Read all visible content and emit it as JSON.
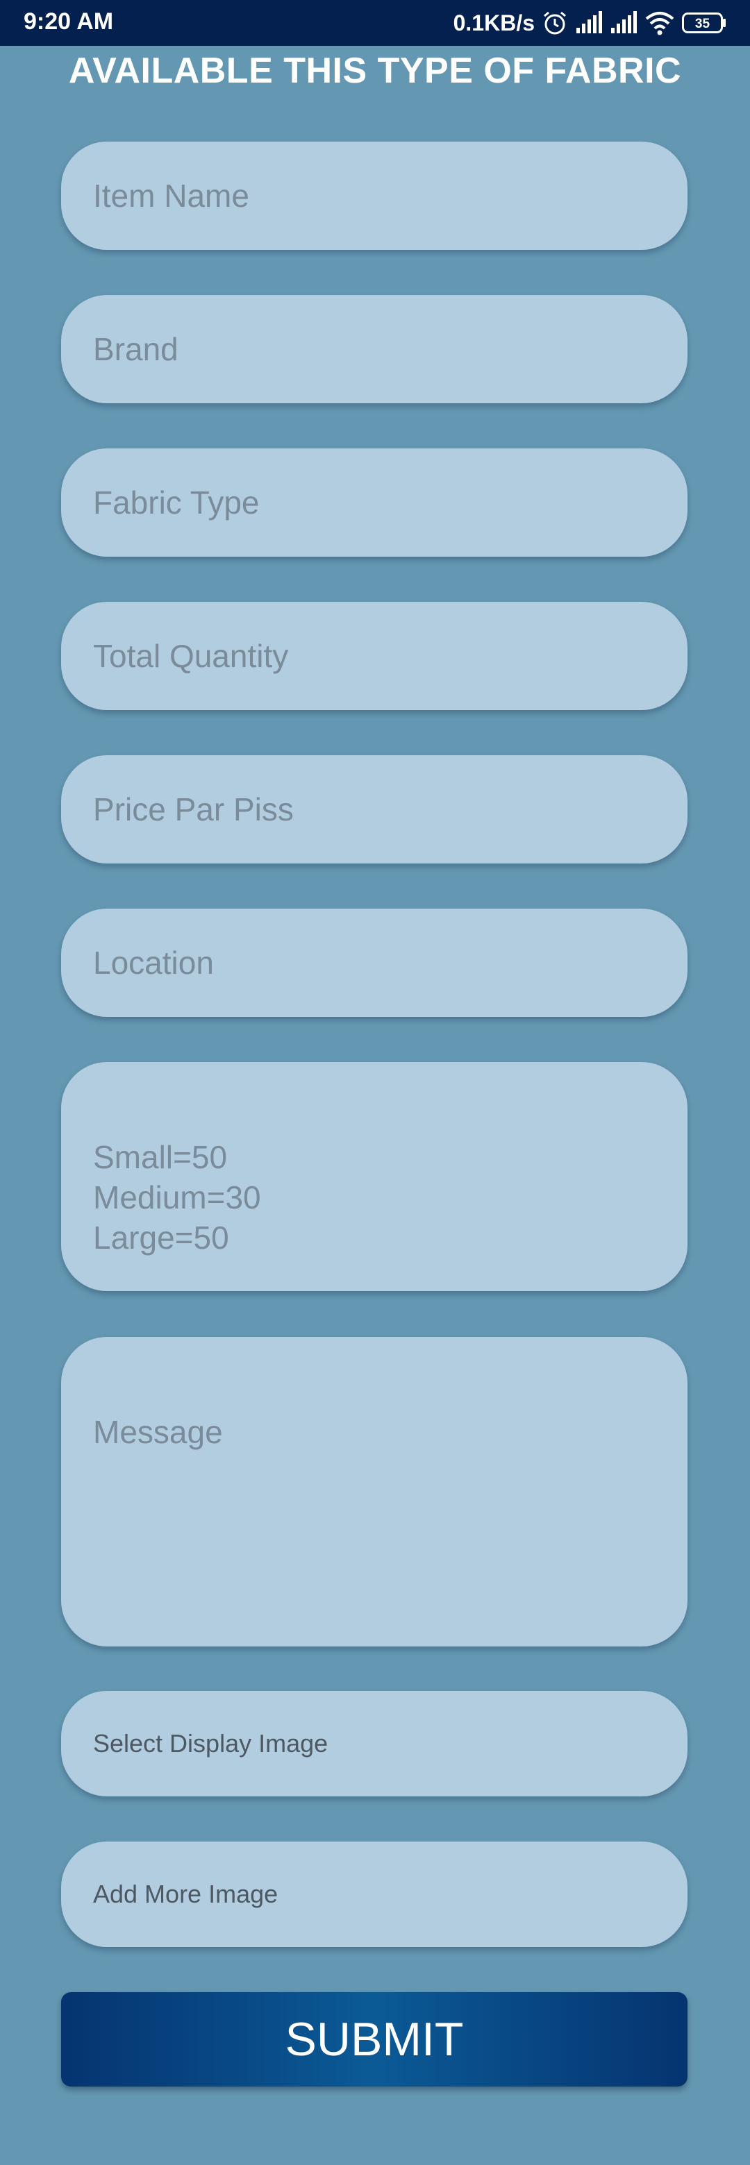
{
  "status_bar": {
    "time": "9:20 AM",
    "net_speed": "0.1KB/s",
    "battery_level": "35",
    "icons": [
      "alarm-icon",
      "signal-icon",
      "signal-icon",
      "wifi-icon",
      "battery-icon"
    ]
  },
  "page": {
    "title": "AVAILABLE THIS TYPE OF FABRIC"
  },
  "form": {
    "item_name_placeholder": "Item Name",
    "brand_placeholder": "Brand",
    "fabric_type_placeholder": "Fabric Type",
    "total_quantity_placeholder": "Total Quantity",
    "price_placeholder": "Price Par Piss",
    "location_placeholder": "Location",
    "size_placeholder": "Small=50\nMedium=30\nLarge=50",
    "message_placeholder": "Message",
    "select_display_image_label": "Select Display Image",
    "add_more_image_label": "Add More Image",
    "submit_label": "SUBMIT"
  },
  "colors": {
    "background": "#6497b1",
    "field": "#b3cde0",
    "status_bar": "#04204f",
    "submit": "#0b5a96"
  }
}
